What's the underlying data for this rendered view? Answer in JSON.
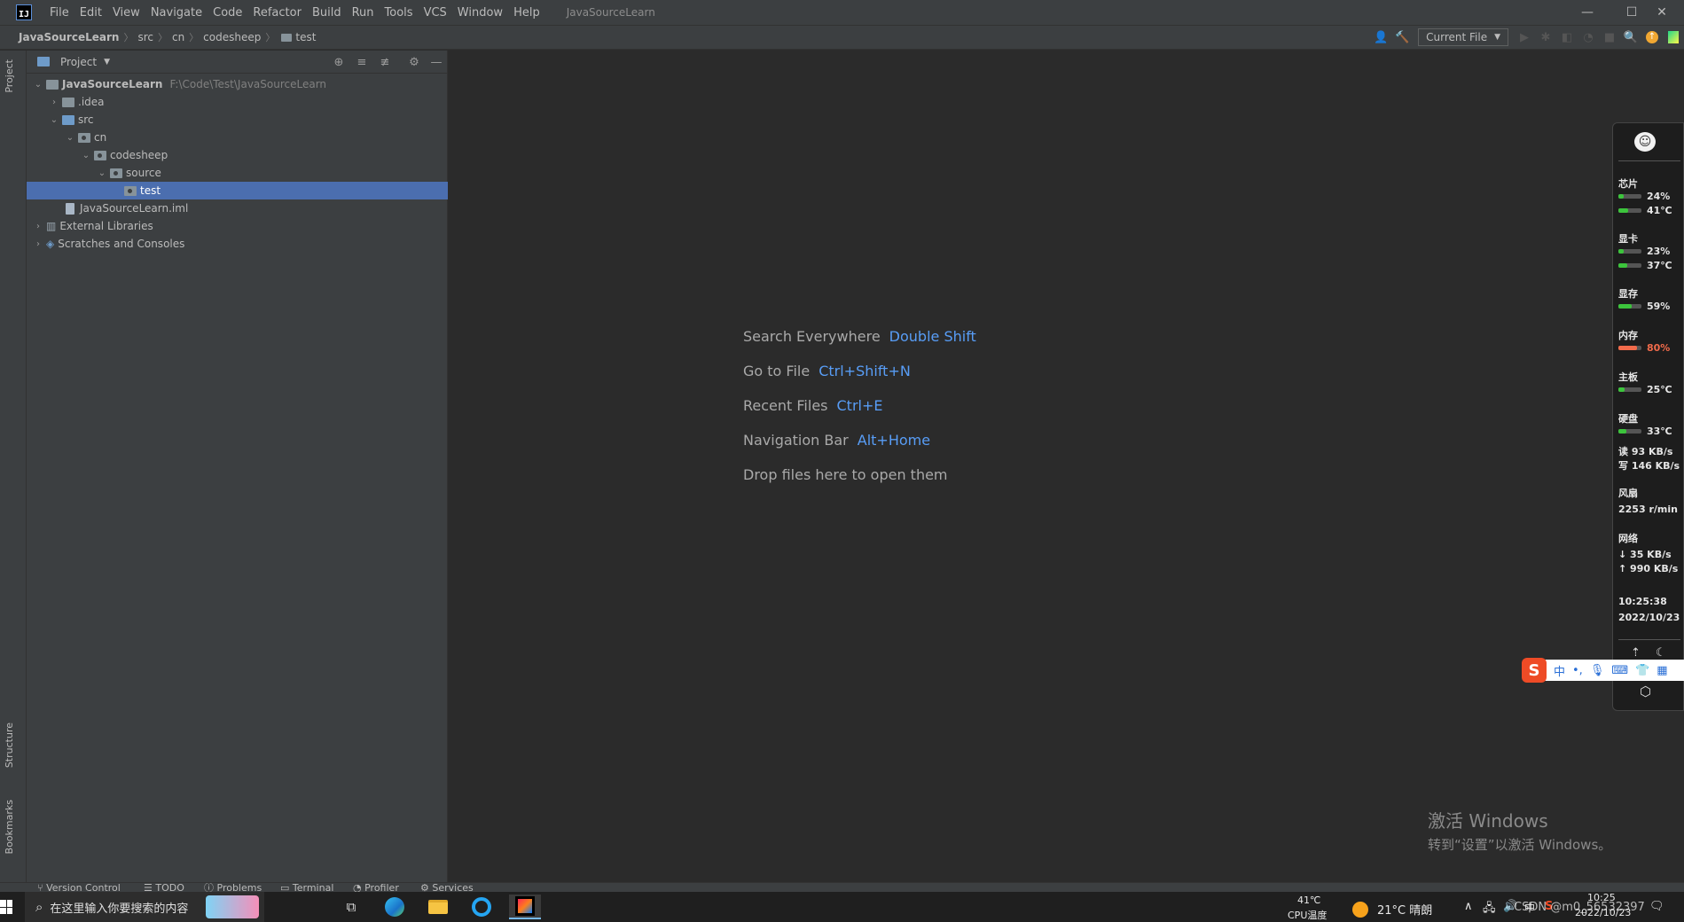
{
  "titlebar": {
    "logo": "IJ",
    "menu": [
      "File",
      "Edit",
      "View",
      "Navigate",
      "Code",
      "Refactor",
      "Build",
      "Run",
      "Tools",
      "VCS",
      "Window",
      "Help"
    ],
    "window_title": "JavaSourceLearn",
    "controls": {
      "minimize": "—",
      "maximize": "☐",
      "close": "✕"
    }
  },
  "navbar": {
    "breadcrumb": [
      "JavaSourceLearn",
      "src",
      "cn",
      "codesheep",
      "test"
    ],
    "run_config": "Current File"
  },
  "left_strip": {
    "tabs": [
      "Project",
      "Structure",
      "Bookmarks"
    ]
  },
  "project_panel": {
    "title": "Project",
    "tree": [
      {
        "label": "JavaSourceLearn",
        "hint": "F:\\Code\\Test\\JavaSourceLearn",
        "depth": 0,
        "expanded": true,
        "kind": "module"
      },
      {
        "label": ".idea",
        "depth": 1,
        "expanded": false,
        "kind": "folder"
      },
      {
        "label": "src",
        "depth": 1,
        "expanded": true,
        "kind": "source"
      },
      {
        "label": "cn",
        "depth": 2,
        "expanded": true,
        "kind": "package"
      },
      {
        "label": "codesheep",
        "depth": 3,
        "expanded": true,
        "kind": "package"
      },
      {
        "label": "source",
        "depth": 4,
        "expanded": true,
        "kind": "package"
      },
      {
        "label": "test",
        "depth": 5,
        "expanded": false,
        "kind": "package",
        "selected": true
      },
      {
        "label": "JavaSourceLearn.iml",
        "depth": 2,
        "kind": "file"
      },
      {
        "label": "External Libraries",
        "depth": 0,
        "expanded": false,
        "kind": "library"
      },
      {
        "label": "Scratches and Consoles",
        "depth": 0,
        "expanded": false,
        "kind": "scratch"
      }
    ]
  },
  "editor": {
    "hints": [
      {
        "text": "Search Everywhere",
        "key": "Double Shift"
      },
      {
        "text": "Go to File",
        "key": "Ctrl+Shift+N"
      },
      {
        "text": "Recent Files",
        "key": "Ctrl+E"
      },
      {
        "text": "Navigation Bar",
        "key": "Alt+Home"
      },
      {
        "text": "Drop files here to open them",
        "key": ""
      }
    ],
    "activation": {
      "line1": "激活 Windows",
      "line2": "转到“设置”以激活 Windows。"
    }
  },
  "bottom_bar": {
    "tabs": [
      "Version Control",
      "TODO",
      "Problems",
      "Terminal",
      "Profiler",
      "Services"
    ]
  },
  "hw_monitor": {
    "chip": {
      "label": "芯片",
      "usage": "24%",
      "usage_pct": 24,
      "temp": "41℃",
      "temp_pct": 41
    },
    "gpu": {
      "label": "显卡",
      "usage": "23%",
      "usage_pct": 23,
      "temp": "37℃",
      "temp_pct": 37
    },
    "vram": {
      "label": "显存",
      "usage": "59%",
      "usage_pct": 59
    },
    "memory": {
      "label": "内存",
      "usage": "80%",
      "usage_pct": 80
    },
    "board": {
      "label": "主板",
      "temp": "25℃",
      "temp_pct": 25
    },
    "disk": {
      "label": "硬盘",
      "temp": "33℃",
      "temp_pct": 33,
      "read": "读 93 KB/s",
      "write": "写 146 KB/s"
    },
    "fan": {
      "label": "风扇",
      "speed": "2253 r/min"
    },
    "network": {
      "label": "网络",
      "down": "↓ 35 KB/s",
      "up": "↑ 990 KB/s"
    },
    "time": "10:25:38",
    "date": "2022/10/23",
    "colors": {
      "ok": "#3cc43c",
      "warn": "#f26b4b"
    }
  },
  "ime": {
    "logo": "S",
    "mode": "中"
  },
  "taskbar": {
    "search_placeholder": "在这里输入你要搜索的内容",
    "cpu_temp": "41℃",
    "cpu_label": "CPU温度",
    "weather": "21°C 晴朗",
    "input_mode": "中",
    "watermark": "CSDN @m0_56532397",
    "time": "10:25",
    "date": "2022/10/23"
  }
}
